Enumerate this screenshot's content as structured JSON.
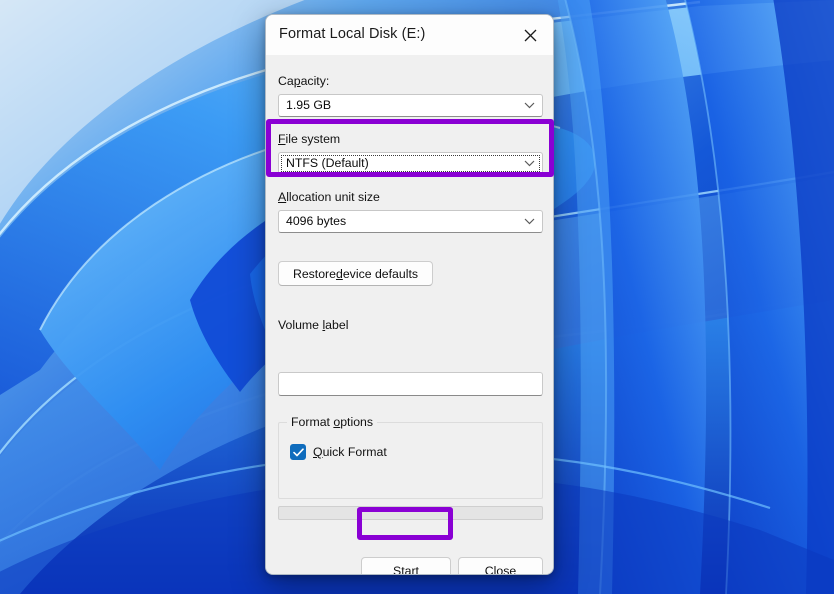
{
  "desktop": {
    "wallpaper_name": "windows-11-bloom-wallpaper",
    "colors": {
      "deep_blue": "#0b3fd4",
      "mid_blue": "#1a74e8",
      "light_blue": "#5ab4f5",
      "pale_blue": "#cfe4f5",
      "highlight_purple": "#8a00d4"
    }
  },
  "dialog": {
    "title": "Format Local Disk (E:)",
    "close_icon": "close-icon",
    "capacity": {
      "label": "Capacity:",
      "label_mnemonic": "p",
      "value": "1.95 GB",
      "chevron_icon": "chevron-down-icon"
    },
    "file_system": {
      "label": "File system",
      "label_mnemonic": "F",
      "value": "NTFS (Default)",
      "chevron_icon": "chevron-down-icon",
      "focused": true,
      "highlighted": true
    },
    "allocation_unit_size": {
      "label": "Allocation unit size",
      "label_mnemonic": "A",
      "value": "4096 bytes",
      "chevron_icon": "chevron-down-icon"
    },
    "restore_defaults_button": {
      "text_before": "Restore ",
      "mnemonic": "d",
      "text_after": "evice defaults"
    },
    "volume_label": {
      "label_before": "Volume ",
      "label_mnemonic": "l",
      "label_after": "abel",
      "value": "",
      "placeholder": ""
    },
    "format_options": {
      "legend_before": "Format ",
      "legend_mnemonic": "o",
      "legend_after": "ptions",
      "quick_format": {
        "mnemonic": "Q",
        "label_after": "uick Format",
        "checked": true,
        "check_icon": "checkmark-icon",
        "color": "#0f6cbd"
      }
    },
    "progress": {
      "percent": 0,
      "value_text": ""
    },
    "start_button": {
      "mnemonic": "S",
      "text_after": "tart",
      "highlighted": true
    },
    "close_button": {
      "mnemonic": "C",
      "text_after": "lose"
    }
  }
}
